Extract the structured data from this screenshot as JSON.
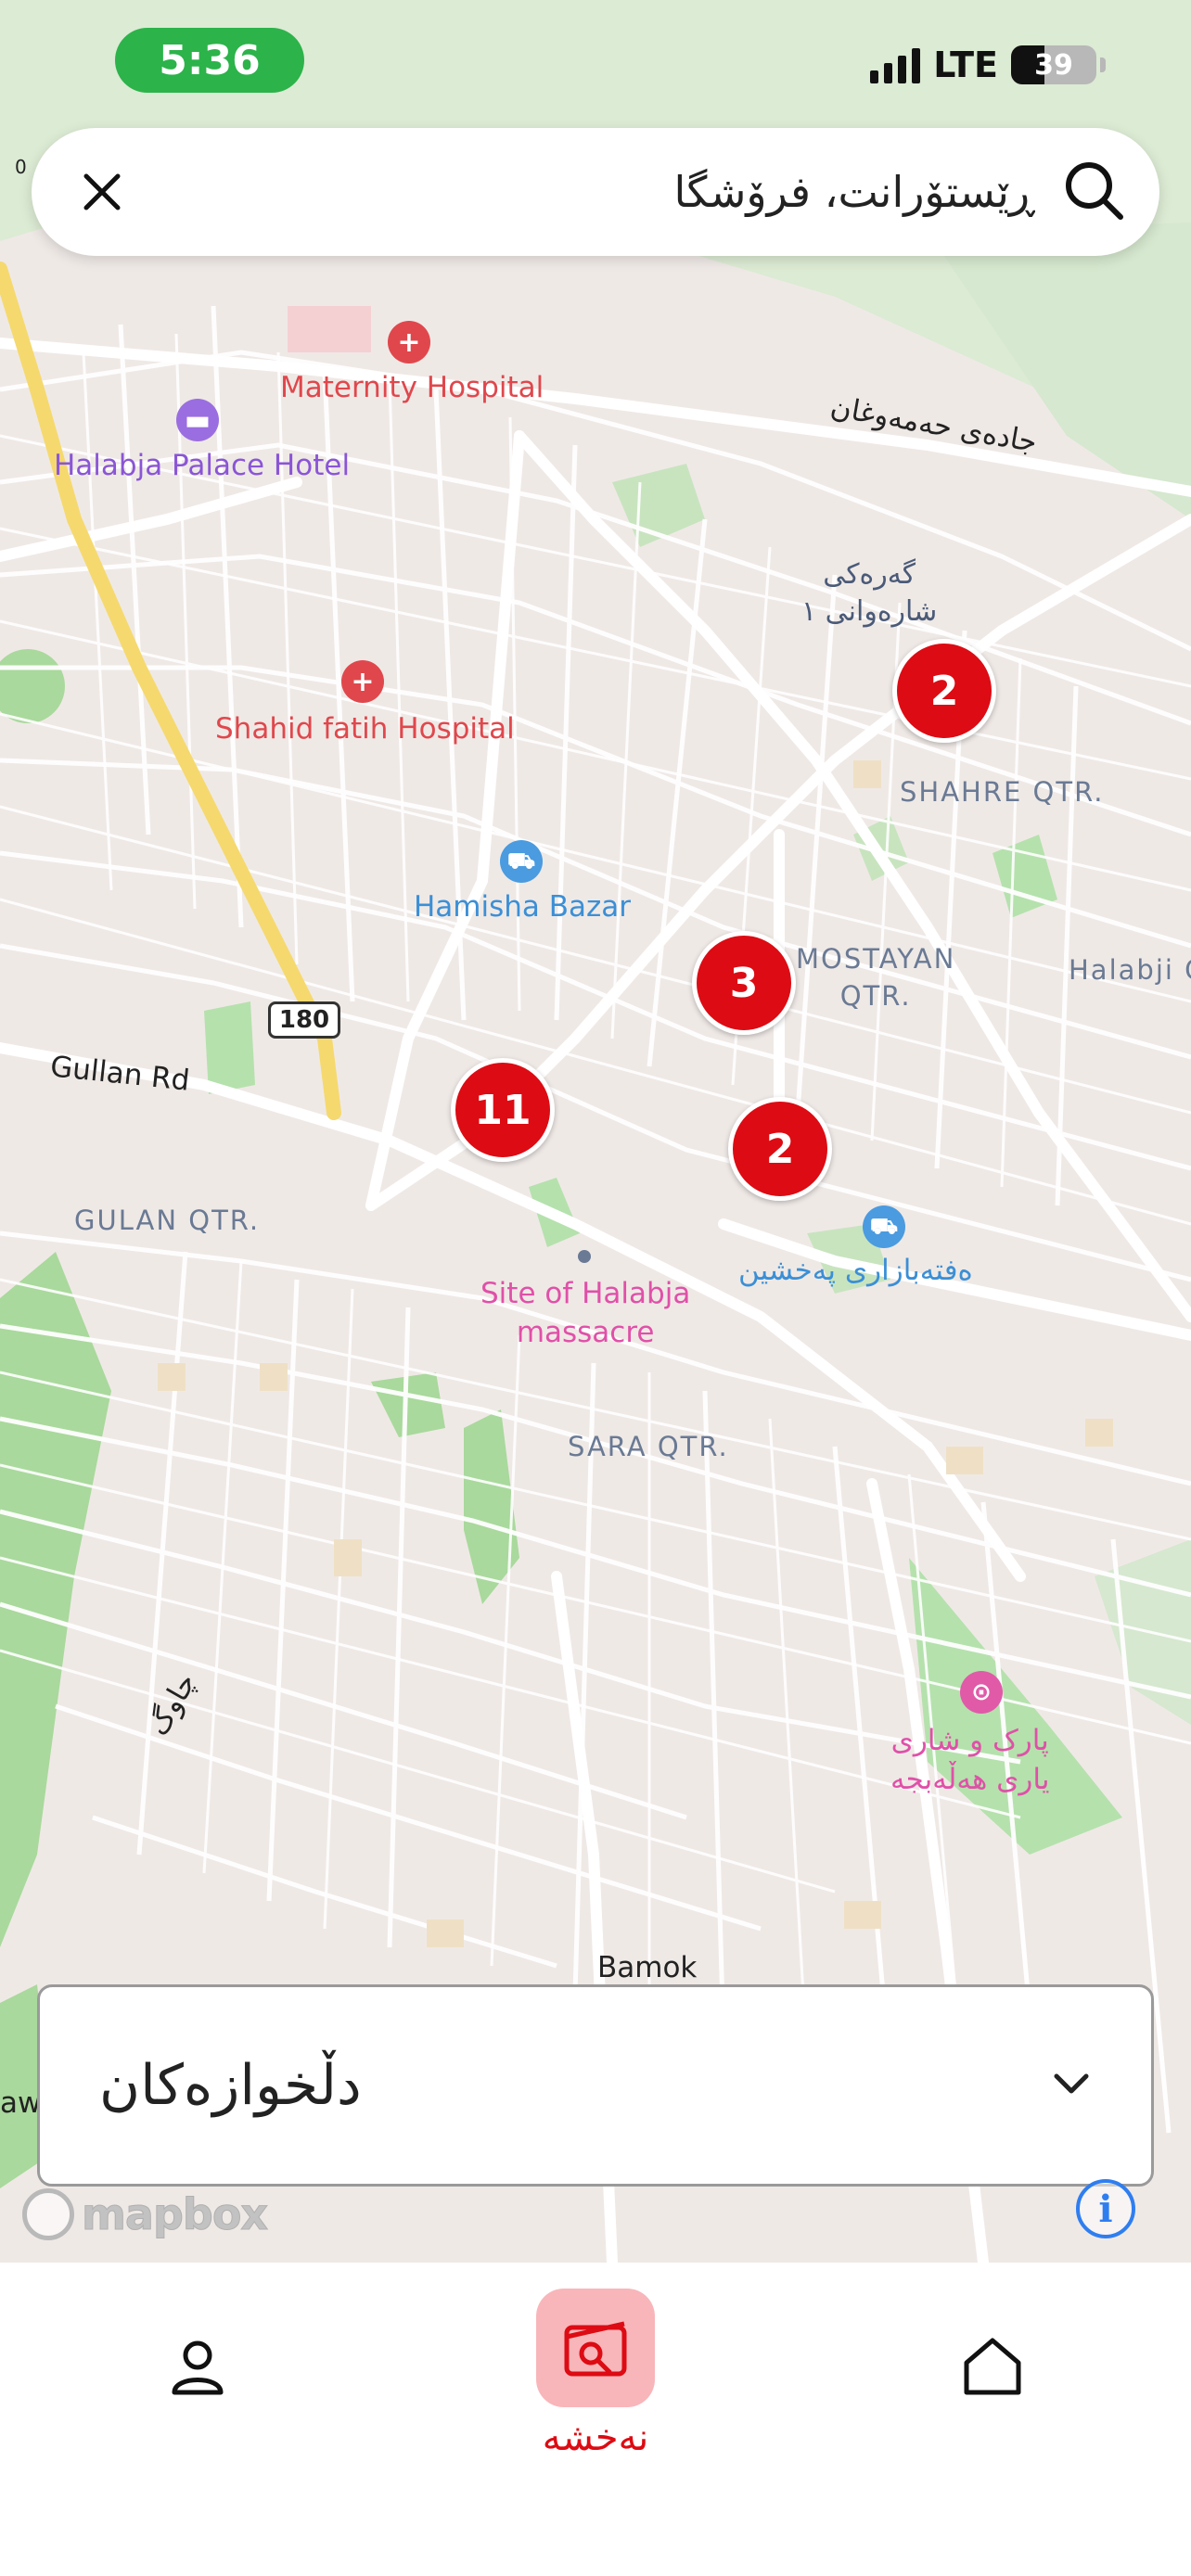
{
  "status_bar": {
    "time": "5:36",
    "network": "LTE",
    "battery_level": "39",
    "battery_fraction": 0.39
  },
  "search": {
    "placeholder": "ڕێستۆرانت، فرۆشگا",
    "value": ""
  },
  "map": {
    "labels": {
      "maternity_hospital": "Maternity Hospital",
      "palace_hotel": "Halabja Palace Hotel",
      "shahid_hospital": "Shahid fatih Hospital",
      "hamisha_bazar": "Hamisha Bazar",
      "gullan_rd": "Gullan Rd",
      "gulan_qtr": "GULAN QTR.",
      "shahre_qtr": "SHAHRE QTR.",
      "mostayan_qtr": "MOSTAYAN\nQTR.",
      "halabji_edge": "Halabji G",
      "site_massacre": "Site of Halabja\nmassacre",
      "sara_qtr": "SARA QTR.",
      "bamok": "Bamok",
      "road_ku_top": "جادەی حەمەوغان",
      "garage_ku": "گەرەکی\nشارەوانی ١",
      "bazar_ku": "ەفتەبازاری پەخشین",
      "park_ku": "پارک و شاری\nیاری هەڵەبجە",
      "road_ku_left": "چاوگ",
      "edge_left": "aw",
      "zoom_marker": "0",
      "highway_shield": "180"
    },
    "clusters": [
      {
        "count": "2"
      },
      {
        "count": "3"
      },
      {
        "count": "11"
      },
      {
        "count": "2"
      }
    ],
    "attribution": "mapbox",
    "info_icon_glyph": "i"
  },
  "favorites": {
    "title": "دڵخوازەکان"
  },
  "bottom_nav": {
    "map_label": "نەخشە"
  },
  "colors": {
    "brand_red": "#dd0b13",
    "active_tab_bg": "#f8b6ba",
    "status_green": "#2cb34a",
    "map_background": "#efe9e6",
    "park_green": "#b5e1ad"
  }
}
